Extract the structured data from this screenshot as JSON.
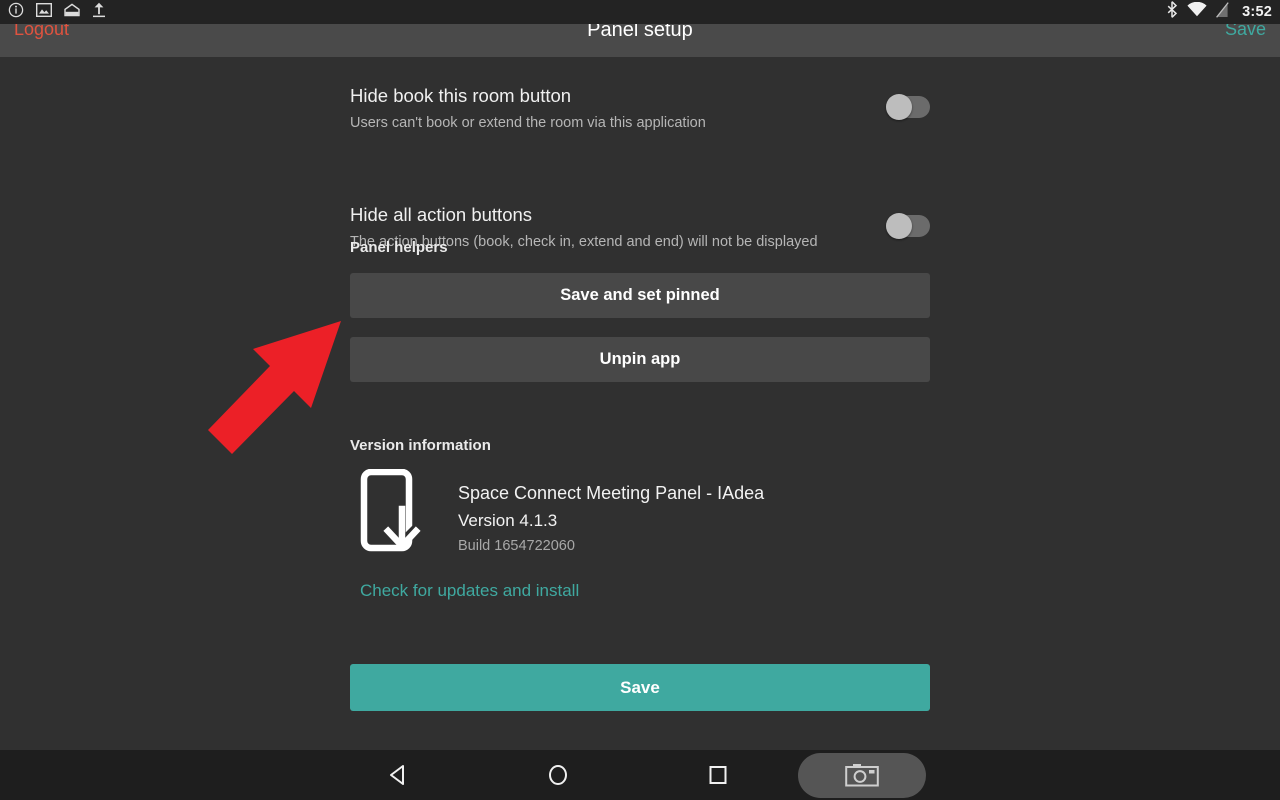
{
  "status_bar": {
    "time": "3:52",
    "left_icons": [
      "info-icon",
      "image-icon",
      "open-envelope-icon",
      "upload-icon"
    ],
    "right_icons": [
      "bluetooth-icon",
      "wifi-icon",
      "signal-off-icon"
    ]
  },
  "header": {
    "title": "Panel setup",
    "logout_label": "Logout",
    "save_label": "Save",
    "logout_color": "#e0533f",
    "save_color": "#3fa9a0"
  },
  "settings": [
    {
      "title": "Hide book this room button",
      "subtitle": "Users can't book or extend the room via this application",
      "toggle_state": "off"
    },
    {
      "title": "Hide all action buttons",
      "subtitle": "The action buttons (book, check in, extend and end) will not be displayed",
      "toggle_state": "off"
    }
  ],
  "panel_helpers": {
    "section_label": "Panel helpers",
    "buttons": [
      {
        "label": "Save and set pinned"
      },
      {
        "label": "Unpin app"
      }
    ]
  },
  "version_information": {
    "section_label": "Version information",
    "icon": "device-download-icon",
    "app_name": "Space Connect Meeting Panel - IAdea",
    "version": "Version 4.1.3",
    "build": "Build 1654722060",
    "update_link": "Check for updates and install"
  },
  "footer": {
    "save_label": "Save",
    "save_color": "#3fa9a0"
  },
  "annotation": {
    "arrow": "red-arrow-pointing-up-right",
    "color": "#ec2027"
  },
  "nav_bar": {
    "buttons": [
      "back-icon",
      "home-icon",
      "recents-icon",
      "screenshot-camera-icon"
    ]
  }
}
